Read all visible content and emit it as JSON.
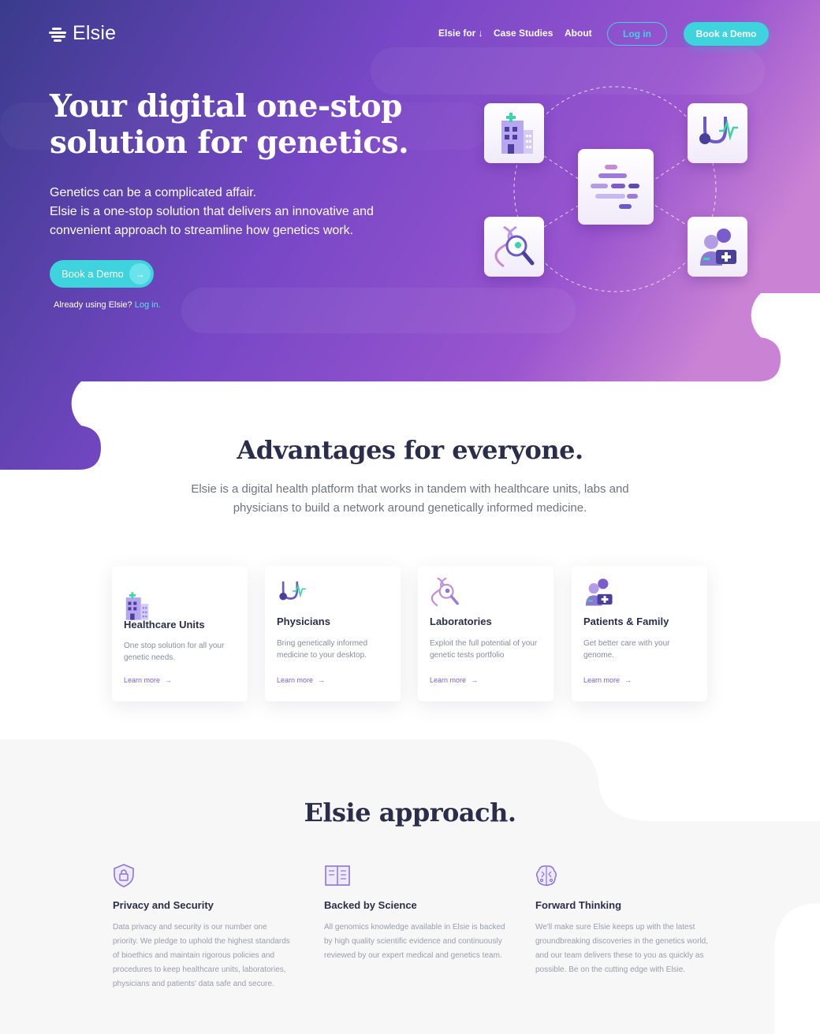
{
  "nav": {
    "logo_text": "Elsie",
    "links": [
      "Elsie for ↓",
      "Case Studies",
      "About"
    ],
    "login": "Log in",
    "demo": "Book a Demo"
  },
  "hero": {
    "title_line1": "Your digital one-stop",
    "title_line2": "solution for genetics.",
    "sub_line1": "Genetics can be a complicated affair.",
    "sub_line2": "Elsie is a one-stop solution that delivers an innovative and convenient approach to streamline how genetics work.",
    "cta": "Book a Demo",
    "cta_arrow": "→",
    "already_text": "Already using Elsie?",
    "already_link": "Log in."
  },
  "advantages": {
    "title": "Advantages for everyone.",
    "subtitle": "Elsie is a digital health platform that works in tandem with healthcare units, labs and physicians to build a network around genetically informed medicine.",
    "cards": [
      {
        "title": "Healthcare Units",
        "desc": "One stop solution for all your genetic needs.",
        "link": "Learn more",
        "icon": "hospital-icon"
      },
      {
        "title": "Physicians",
        "desc": "Bring genetically informed medicine to your desktop.",
        "link": "Learn more",
        "icon": "stethoscope-icon"
      },
      {
        "title": "Laboratories",
        "desc": "Exploit the full potential of your genetic tests portfolio",
        "link": "Learn more",
        "icon": "dna-magnifier-icon"
      },
      {
        "title": "Patients & Family",
        "desc": "Get better care with your genome.",
        "link": "Learn more",
        "icon": "family-icon"
      }
    ],
    "link_arrow": "→"
  },
  "approach": {
    "title": "Elsie approach.",
    "features": [
      {
        "title": "Privacy and Security",
        "desc": "Data privacy and security is our number one priority. We pledge to uphold the highest standards of bioethics and maintain rigorous policies and procedures to keep healthcare units, laboratories, physicians and patients' data safe and secure.",
        "icon": "shield-lock-icon"
      },
      {
        "title": "Backed by Science",
        "desc": "All genomics knowledge available in Elsie is backed by high quality scientific evidence and continuously reviewed by our expert medical and genetics team.",
        "icon": "book-icon"
      },
      {
        "title": "Forward Thinking",
        "desc": "We'll make sure Elsie keeps up with the latest groundbreaking discoveries in the genetics world, and our team delivers these to you as quickly as possible. Be on the cutting edge with Elsie.",
        "icon": "brain-icon"
      }
    ]
  },
  "colors": {
    "hero_start": "#3b3a8c",
    "hero_mid": "#7a49c7",
    "hero_end": "#c77fd2",
    "accent": "#3ed3dd",
    "link": "#7a62c8",
    "approach_bg": "#f7f7f8"
  }
}
